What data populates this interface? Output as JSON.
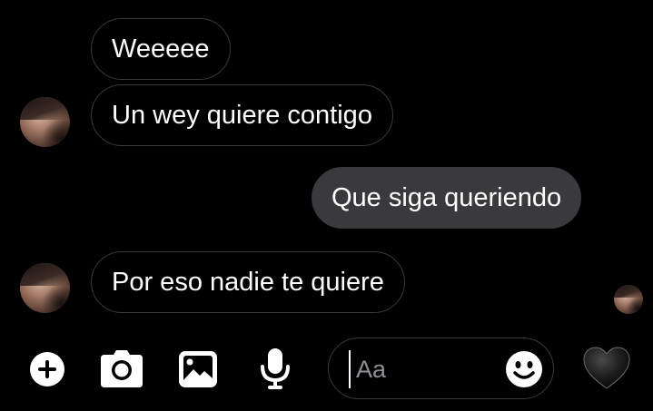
{
  "messages": [
    {
      "direction": "incoming",
      "text": "Weeeee"
    },
    {
      "direction": "incoming",
      "text": "Un wey quiere contigo"
    },
    {
      "direction": "outgoing",
      "text": "Que siga queriendo"
    },
    {
      "direction": "incoming",
      "text": "Por eso nadie te quiere"
    }
  ],
  "composer": {
    "placeholder": "Aa"
  },
  "toolbar": {
    "icons": [
      "add-icon",
      "camera-icon",
      "image-icon",
      "microphone-icon",
      "emoji-icon",
      "heart-icon"
    ]
  },
  "colors": {
    "background": "#000000",
    "outgoing_bubble": "#3a3a3c",
    "incoming_border": "#3a3a3c",
    "text": "#ffffff",
    "placeholder": "#8e8e93"
  }
}
